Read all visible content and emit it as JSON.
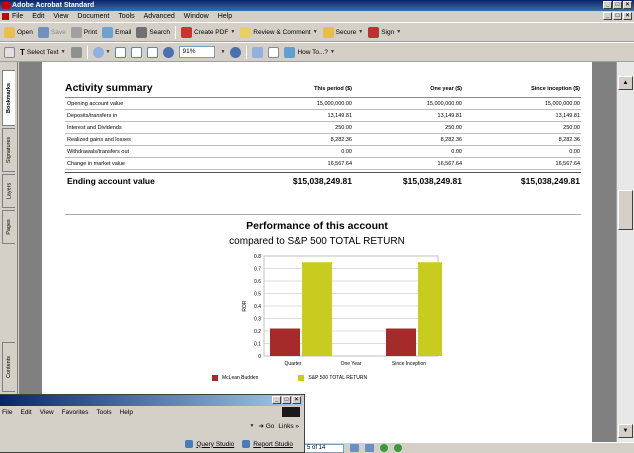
{
  "window": {
    "title": "Adobe Acrobat Standard",
    "controls": [
      "_",
      "□",
      "×"
    ]
  },
  "menubar": {
    "items": [
      "File",
      "Edit",
      "View",
      "Document",
      "Tools",
      "Advanced",
      "Window",
      "Help"
    ]
  },
  "toolbar1": {
    "open": "Open",
    "save": "Save",
    "print": "Print",
    "email": "Email",
    "search": "Search",
    "create_pdf": "Create PDF",
    "review": "Review & Comment",
    "secure": "Secure",
    "sign": "Sign"
  },
  "toolbar2": {
    "select_text": "Select Text",
    "zoom": "91%",
    "howto": "How To...?"
  },
  "nav_tabs": {
    "bookmarks": "Bookmarks",
    "signatures": "Signatures",
    "layers": "Layers",
    "pages": "Pages",
    "contents": "Contents"
  },
  "activity": {
    "title": "Activity summary",
    "columns": [
      "This period ($)",
      "One year ($)",
      "Since inception ($)"
    ],
    "rows": [
      {
        "label": "Opening account value",
        "v1": "15,000,000.00",
        "v2": "15,000,000.00",
        "v3": "15,000,000.00"
      },
      {
        "label": "Deposits/transfers in",
        "v1": "13,149.81",
        "v2": "13,149.81",
        "v3": "13,149.81"
      },
      {
        "label": "Interest and Dividends",
        "v1": "250.00",
        "v2": "250.00",
        "v3": "250.00"
      },
      {
        "label": "Realized gains and losses",
        "v1": "8,282.36",
        "v2": "8,282.36",
        "v3": "8,282.36"
      },
      {
        "label": "Withdrawals/transfers out",
        "v1": "0.00",
        "v2": "0.00",
        "v3": "0.00"
      },
      {
        "label": "Change in market value",
        "v1": "16,567.64",
        "v2": "16,567.64",
        "v3": "16,567.64"
      }
    ],
    "total": {
      "label": "Ending account value",
      "v1": "$15,038,249.81",
      "v2": "$15,038,249.81",
      "v3": "$15,038,249.81"
    }
  },
  "chart_heading": {
    "title": "Performance of this account",
    "subtitle": "compared to S&P 500 TOTAL RETURN"
  },
  "chart_data": {
    "type": "bar",
    "categories": [
      "Quarter",
      "One Year",
      "Since Inception"
    ],
    "series": [
      {
        "name": "McLean Budden",
        "values": [
          0.22,
          0,
          0.22
        ],
        "color": "#a52a2a"
      },
      {
        "name": "S&P 500 TOTAL RETURN",
        "values": [
          0.75,
          0,
          0.75
        ],
        "color": "#c8cc1e"
      }
    ],
    "ylabel": "ROR",
    "ylim": [
      0,
      0.8
    ],
    "yticks": [
      "0",
      "0.1",
      "0.2",
      "0.3",
      "0.4",
      "0.5",
      "0.6",
      "0.7",
      "0.8"
    ],
    "grid": true,
    "legend": "bottom"
  },
  "statusbar": {
    "page": "5 of 14"
  },
  "ie_window": {
    "menu": [
      "File",
      "Edit",
      "View",
      "Favorites",
      "Tools",
      "Help"
    ],
    "go": "Go",
    "links": "Links »",
    "link1": "Query Studio",
    "link2": "Report Studio"
  },
  "colors": {
    "titlebar": "#0a246a",
    "series1": "#a52a2a",
    "series2": "#c8cc1e"
  }
}
